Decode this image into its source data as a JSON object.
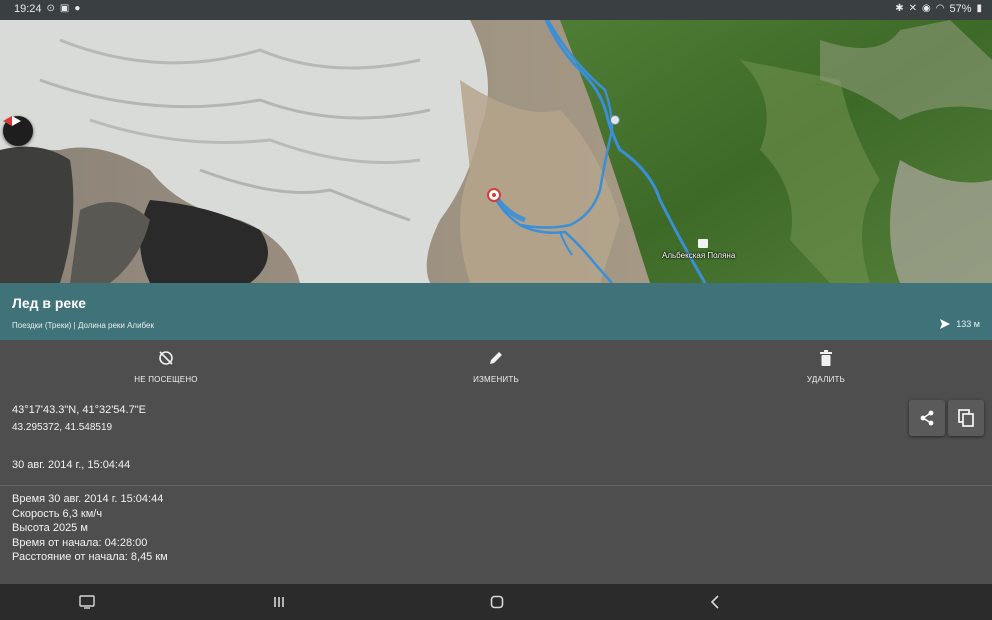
{
  "status_bar": {
    "time": "19:24",
    "battery": "57%",
    "left_icons": [
      "target-icon",
      "image-icon",
      "pin-icon"
    ],
    "right_icons": [
      "bluetooth-icon",
      "mute-icon",
      "location-icon",
      "wifi-icon",
      "battery-icon"
    ]
  },
  "map": {
    "place_label": "Альбекская Поляна",
    "colors": {
      "track": "#3a8fd6",
      "glacier": "#d7d9d6",
      "forest": "#3f6e2a",
      "rock": "#a89880"
    }
  },
  "point": {
    "title": "Лед в реке",
    "breadcrumb": "Поездки (Треки) | Долина реки Алибек",
    "distance": "133 м"
  },
  "actions": [
    {
      "label": "НЕ ПОСЕЩЕНО",
      "icon": "eye-off-icon"
    },
    {
      "label": "ИЗМЕНИТЬ",
      "icon": "pencil-icon"
    },
    {
      "label": "УДАЛИТЬ",
      "icon": "trash-icon"
    }
  ],
  "info": {
    "coords_dms": "43°17'43.3\"N, 41°32'54.7\"E",
    "coords_decimal": "43.295372, 41.548519",
    "date": "30 авг. 2014 г., 15:04:44",
    "stats": [
      "Время 30 авг. 2014 г. 15:04:44",
      "Скорость 6,3 км/ч",
      "Высота 2025 м",
      "Время от начала: 04:28:00",
      "Расстояние от начала: 8,45 км"
    ]
  },
  "nav": {
    "icons": [
      "screenshot-icon",
      "recents-icon",
      "home-icon",
      "back-icon"
    ]
  }
}
